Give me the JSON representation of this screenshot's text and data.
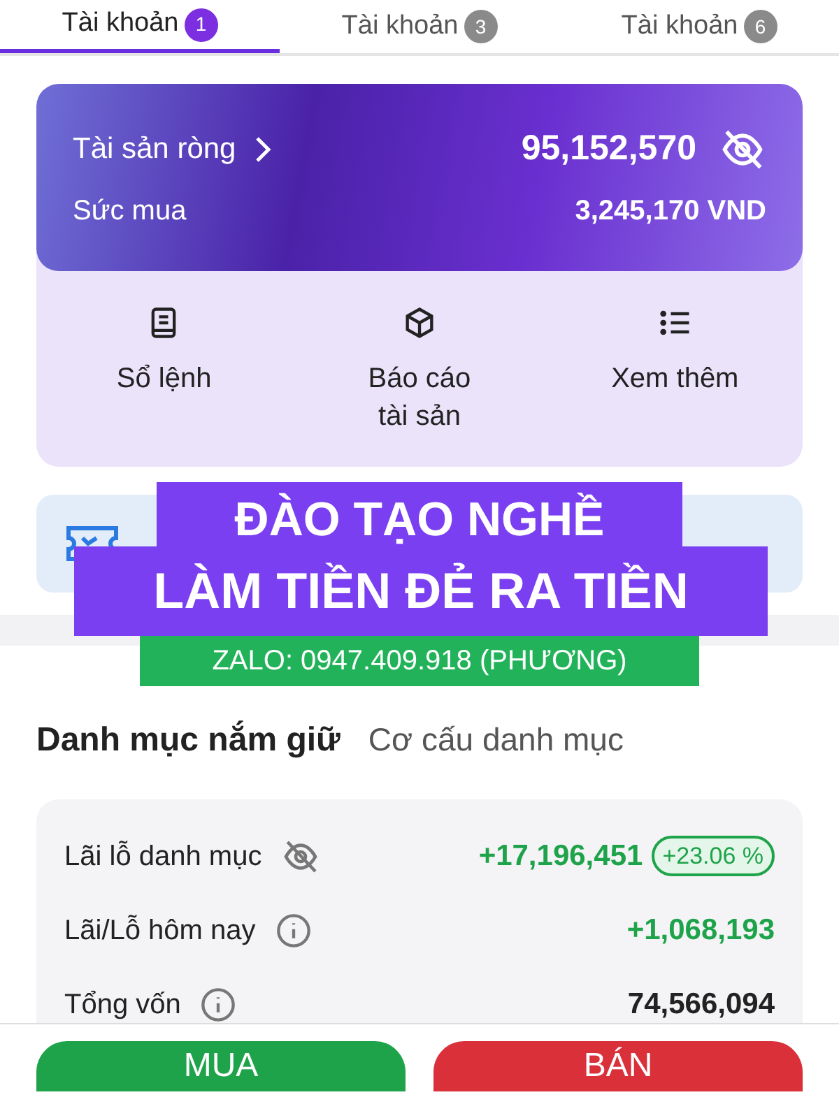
{
  "tabs": [
    {
      "label": "Tài khoản",
      "count": "1",
      "selected": true
    },
    {
      "label": "Tài khoản",
      "count": "3",
      "selected": false
    },
    {
      "label": "Tài khoản",
      "count": "6",
      "selected": false
    }
  ],
  "summary": {
    "net_assets_label": "Tài sản ròng",
    "net_assets_value": "95,152,570",
    "buying_power_label": "Sức mua",
    "buying_power_value": "3,245,170 VND"
  },
  "actions": [
    {
      "label": "Sổ lệnh",
      "kind": "book"
    },
    {
      "label": "Báo cáo tài sản",
      "kind": "box"
    },
    {
      "label": "Xem thêm",
      "kind": "list"
    }
  ],
  "overlay": {
    "line_1": "ĐÀO TẠO NGHỀ",
    "line_2": "LÀM TIỀN ĐẺ RA TIỀN",
    "contact": "ZALO: 0947.409.918 (PHƯƠNG)"
  },
  "section_tabs": [
    {
      "label": "Danh mục nắm giữ",
      "selected": true
    },
    {
      "label": "Cơ cấu danh mục",
      "selected": false
    }
  ],
  "stats": [
    {
      "label": "Lãi lỗ danh mục",
      "kind": "eye",
      "value": "+17,196,451",
      "badge": "+23.06 %",
      "color": "#1fa34a"
    },
    {
      "label": "Lãi/Lỗ hôm nay",
      "kind": "info",
      "value": "+1,068,193",
      "color": "#1fa34a"
    },
    {
      "label": "Tổng vốn",
      "kind": "info",
      "value": "74,566,094",
      "color": "#222222"
    }
  ],
  "buttons": [
    {
      "label": "MUA",
      "kind": "buy"
    },
    {
      "label": "BÁN",
      "kind": "sell"
    }
  ]
}
